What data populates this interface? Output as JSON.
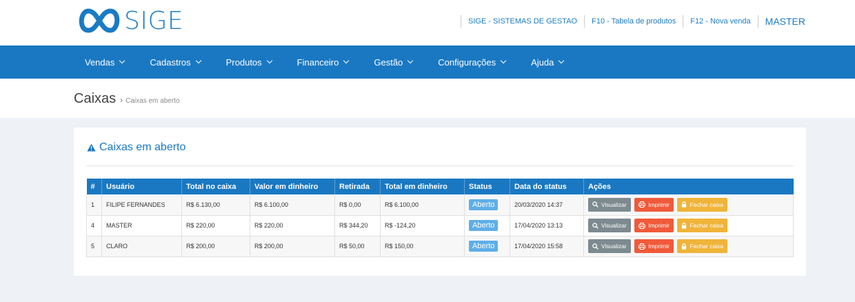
{
  "header": {
    "logo_text": "SIGE",
    "links": [
      {
        "label": "SIGE - SISTEMAS DE GESTAO"
      },
      {
        "label": "F10 - Tabela de produtos"
      },
      {
        "label": "F12 - Nova venda"
      }
    ],
    "user": "MASTER"
  },
  "nav": {
    "items": [
      {
        "label": "Vendas"
      },
      {
        "label": "Cadastros"
      },
      {
        "label": "Produtos"
      },
      {
        "label": "Financeiro"
      },
      {
        "label": "Gestão"
      },
      {
        "label": "Configurações"
      },
      {
        "label": "Ajuda"
      }
    ]
  },
  "breadcrumb": {
    "title": "Caixas",
    "separator": "›",
    "current": "Caixas em aberto"
  },
  "panel": {
    "title": "Caixas em aberto",
    "icon": "warning-icon"
  },
  "table": {
    "headers": [
      "#",
      "Usuário",
      "Total no caixa",
      "Valor em dinheiro",
      "Retirada",
      "Total em dinheiro",
      "Status",
      "Data do status",
      "Ações"
    ],
    "rows": [
      {
        "id": "1",
        "usuario": "FILIPE FERNANDES",
        "total_caixa": "R$ 6.130,00",
        "valor_dinheiro": "R$ 6.100,00",
        "retirada": "R$ 0,00",
        "total_dinheiro": "R$ 6.100,00",
        "status": "Aberto",
        "data_status": "20/03/2020 14:37"
      },
      {
        "id": "4",
        "usuario": "MASTER",
        "total_caixa": "R$ 220,00",
        "valor_dinheiro": "R$ 220,00",
        "retirada": "R$ 344,20",
        "total_dinheiro": "R$ -124,20",
        "status": "Aberto",
        "data_status": "17/04/2020 13:13"
      },
      {
        "id": "5",
        "usuario": "CLARO",
        "total_caixa": "R$ 200,00",
        "valor_dinheiro": "R$ 200,00",
        "retirada": "R$ 50,00",
        "total_dinheiro": "R$ 150,00",
        "status": "Aberto",
        "data_status": "17/04/2020 15:58"
      }
    ],
    "actions": {
      "view_label": "Visualizar",
      "print_label": "Imprimir",
      "close_label": "Fechar caixa"
    }
  },
  "colors": {
    "primary": "#1a78c2",
    "badge": "#5faee8",
    "view": "#7d8a90",
    "print": "#f05a3a",
    "close": "#f0b43a",
    "background": "#eef2f6"
  }
}
